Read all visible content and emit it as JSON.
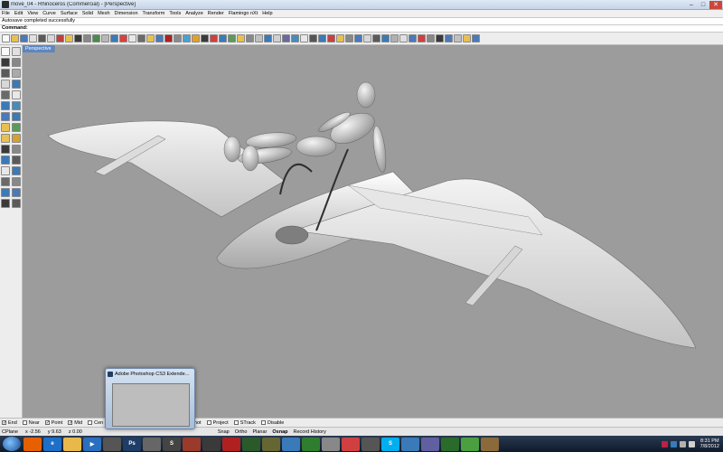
{
  "window": {
    "title": "move_04 - Rhinoceros (Commercial) - [Perspective]",
    "buttons": [
      "–",
      "□",
      "✕"
    ]
  },
  "menu": [
    "File",
    "Edit",
    "View",
    "Curve",
    "Surface",
    "Solid",
    "Mesh",
    "Dimension",
    "Transform",
    "Tools",
    "Analyze",
    "Render",
    "Flamingo nXt",
    "Help"
  ],
  "status_message": "Autosave completed successfully",
  "command": {
    "label": "Command:",
    "value": ""
  },
  "viewport": {
    "tab_label": "Perspective",
    "background": "#9c9c9c"
  },
  "osnap": [
    {
      "label": "End",
      "checked": true
    },
    {
      "label": "Near",
      "checked": false
    },
    {
      "label": "Point",
      "checked": true
    },
    {
      "label": "Mid",
      "checked": true
    },
    {
      "label": "Cen",
      "checked": false
    },
    {
      "label": "Knot",
      "checked": false
    },
    {
      "label": "Project",
      "checked": false
    },
    {
      "label": "STrack",
      "checked": false
    },
    {
      "label": "Disable",
      "checked": false
    }
  ],
  "statusbar": {
    "cplane": "CPlane",
    "x": "x -2.56",
    "y": "y 9.63",
    "z": "z 0.00",
    "panes": [
      "Snap",
      "Ortho",
      "Planar",
      "Osnap",
      "Record History"
    ]
  },
  "taskbar_preview": {
    "title": "Adobe Photoshop CS3 Extende..."
  },
  "taskbar_apps": [
    {
      "name": "firefox",
      "label": "",
      "color": "#e66000"
    },
    {
      "name": "ie",
      "label": "e",
      "color": "#1e6fc8"
    },
    {
      "name": "folder",
      "label": "",
      "color": "#e8b84a"
    },
    {
      "name": "media",
      "label": "▶",
      "color": "#2a6fbe"
    },
    {
      "name": "rhino",
      "label": "",
      "color": "#555555"
    },
    {
      "name": "photoshop",
      "label": "Ps",
      "color": "#1f3d66"
    },
    {
      "name": "app7",
      "label": "",
      "color": "#666666"
    },
    {
      "name": "sketchbook",
      "label": "S",
      "color": "#444444"
    },
    {
      "name": "app9",
      "label": "",
      "color": "#9a3a2a"
    },
    {
      "name": "app10",
      "label": "",
      "color": "#3a3a3a"
    },
    {
      "name": "app11",
      "label": "",
      "color": "#b02020"
    },
    {
      "name": "app12",
      "label": "",
      "color": "#2a5a2a"
    },
    {
      "name": "app13",
      "label": "",
      "color": "#666633"
    },
    {
      "name": "app14",
      "label": "",
      "color": "#3a7ab8"
    },
    {
      "name": "app15",
      "label": "",
      "color": "#2f7d2f"
    },
    {
      "name": "app16",
      "label": "",
      "color": "#888888"
    },
    {
      "name": "app17",
      "label": "",
      "color": "#d04040"
    },
    {
      "name": "app18",
      "label": "",
      "color": "#555555"
    },
    {
      "name": "skype",
      "label": "S",
      "color": "#00aff0"
    },
    {
      "name": "app20",
      "label": "",
      "color": "#3a7ab8"
    },
    {
      "name": "app21",
      "label": "",
      "color": "#6060a0"
    },
    {
      "name": "app22",
      "label": "",
      "color": "#2a6a2a"
    },
    {
      "name": "clock-app",
      "label": "",
      "color": "#4aa040"
    },
    {
      "name": "app24",
      "label": "",
      "color": "#8a6a3a"
    }
  ],
  "clock": {
    "time": "8:31 PM",
    "date": "7/8/2012"
  }
}
